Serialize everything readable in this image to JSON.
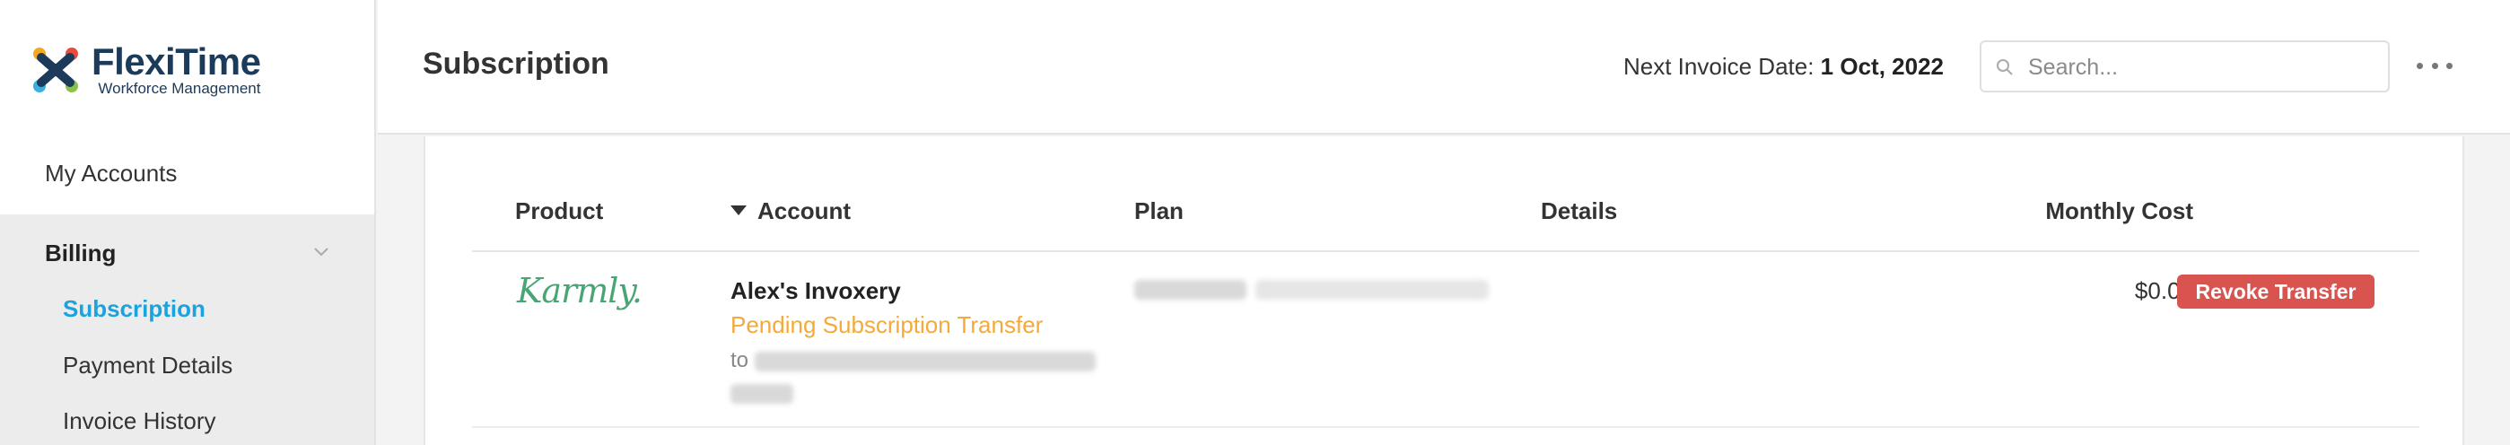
{
  "brand": {
    "name": "FlexiTime",
    "tagline": "Workforce Management"
  },
  "sidebar": {
    "my_accounts": "My Accounts",
    "billing": {
      "label": "Billing",
      "items": [
        {
          "label": "Subscription",
          "active": true
        },
        {
          "label": "Payment Details",
          "active": false
        },
        {
          "label": "Invoice History",
          "active": false
        }
      ]
    }
  },
  "header": {
    "title": "Subscription",
    "next_invoice_label": "Next Invoice Date:",
    "next_invoice_date": "1 Oct, 2022",
    "search_placeholder": "Search..."
  },
  "table": {
    "columns": {
      "product": "Product",
      "account": "Account",
      "plan": "Plan",
      "details": "Details",
      "monthly_cost": "Monthly Cost"
    },
    "rows": [
      {
        "product": "Karmly.",
        "account_name": "Alex's Invoxery",
        "status": "Pending Subscription Transfer",
        "to_prefix": "to",
        "monthly_cost": "$0.00",
        "action": "Revoke Transfer"
      }
    ]
  },
  "colors": {
    "accent": "#1aa3dc",
    "pending": "#f4a93b",
    "danger": "#d9534f",
    "brand_dark": "#1c3a5a",
    "product_green": "#4aa575"
  }
}
